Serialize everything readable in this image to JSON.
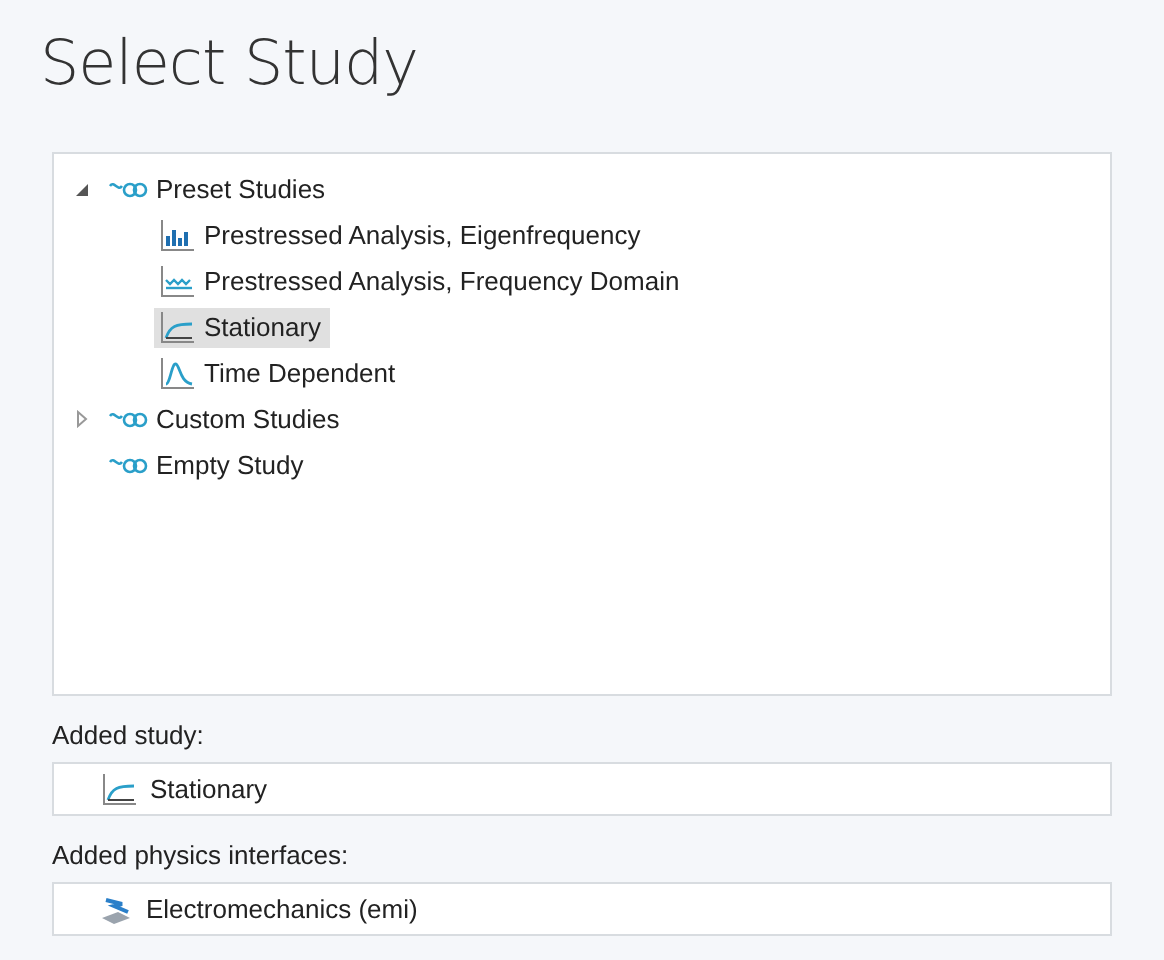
{
  "title": "Select Study",
  "tree": [
    {
      "label": "Preset Studies",
      "kind": "group",
      "expanded": true,
      "selected": false,
      "children": [
        {
          "label": "Prestressed Analysis, Eigenfrequency",
          "kind": "eigenfrequency",
          "selected": false
        },
        {
          "label": "Prestressed Analysis, Frequency Domain",
          "kind": "frequency",
          "selected": false
        },
        {
          "label": "Stationary",
          "kind": "stationary",
          "selected": true
        },
        {
          "label": "Time Dependent",
          "kind": "time",
          "selected": false
        }
      ]
    },
    {
      "label": "Custom Studies",
      "kind": "group",
      "expanded": false,
      "selected": false
    },
    {
      "label": "Empty Study",
      "kind": "group",
      "selected": false
    }
  ],
  "added_study": {
    "label": "Added study:",
    "items": [
      {
        "label": "Stationary",
        "kind": "stationary"
      }
    ]
  },
  "added_physics": {
    "label": "Added physics interfaces:",
    "items": [
      {
        "label": "Electromechanics (emi)",
        "kind": "physics"
      }
    ]
  }
}
